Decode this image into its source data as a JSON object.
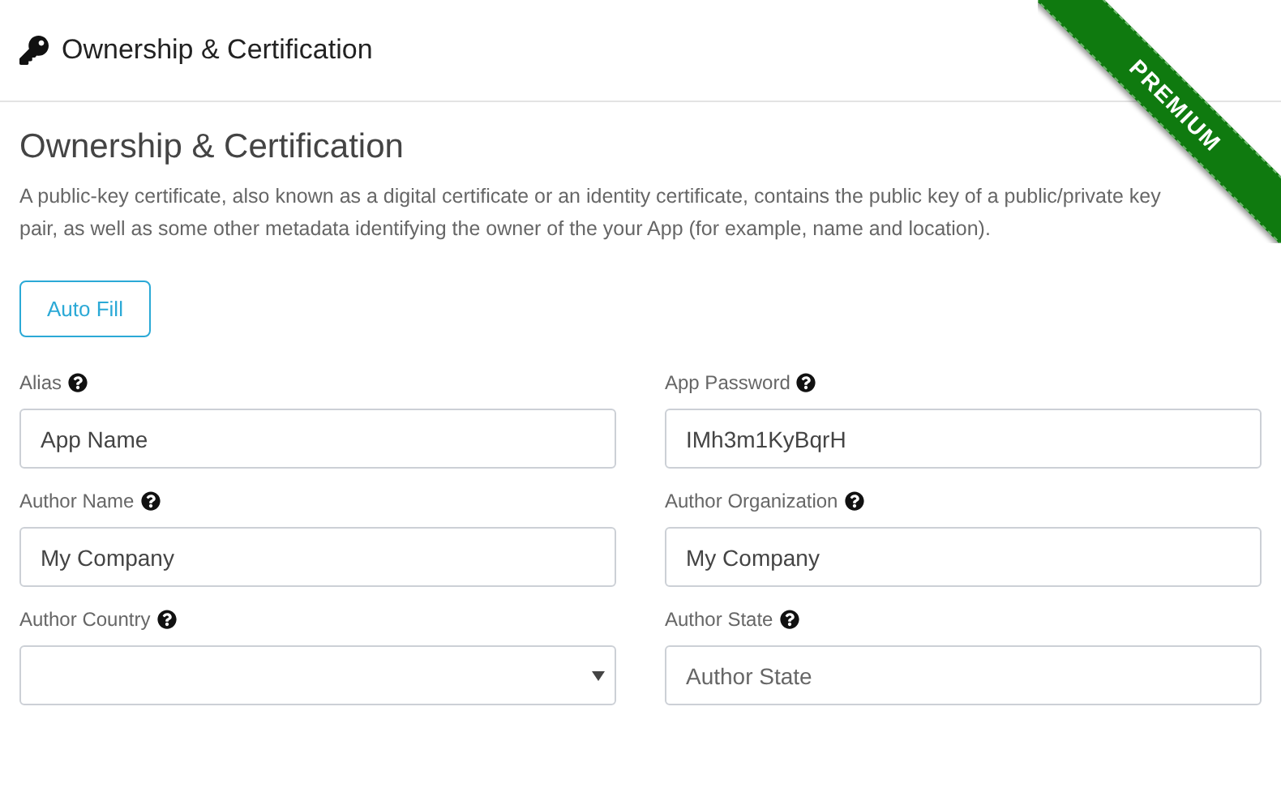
{
  "header": {
    "title": "Ownership & Certification"
  },
  "ribbon": {
    "label": "PREMIUM"
  },
  "section": {
    "title": "Ownership & Certification",
    "description": "A public-key certificate, also known as a digital certificate or an identity certificate, contains the public key of a public/private key pair, as well as some other metadata identifying the owner of the your App (for example, name and location)."
  },
  "auto_fill_button": "Auto Fill",
  "fields": [
    {
      "label": "Alias",
      "kind": "text",
      "value": "App Name"
    },
    {
      "label": "App Password",
      "kind": "text",
      "value": "IMh3m1KyBqrH"
    },
    {
      "label": "Author Name",
      "kind": "text",
      "value": "My Company"
    },
    {
      "label": "Author Organization",
      "kind": "text",
      "value": "My Company"
    },
    {
      "label": "Author Country",
      "kind": "select"
    },
    {
      "label": "Author State",
      "kind": "text",
      "placeholder": "Author State"
    }
  ]
}
